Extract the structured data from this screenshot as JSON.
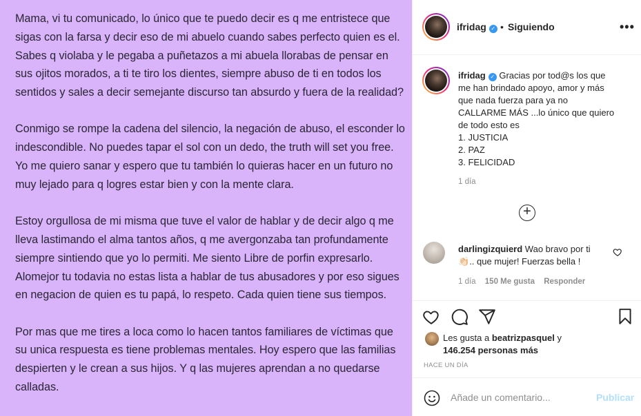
{
  "post_image": {
    "background_color": "#d9b4fb",
    "paragraphs": [
      "Mama, vi tu comunicado, lo único que te puedo decir es q me entristece que sigas con la farsa y decir eso de mi abuelo cuando sabes perfecto quien es el. Sabes q violaba y le pegaba a puñetazos a mi abuela llorabas de pensar en sus ojitos morados, a ti te tiro los dientes, siempre abuso de ti en todos los sentidos y sales a decir semejante discurso tan absurdo y fuera de la realidad?",
      "Conmigo se rompe la cadena del silencio, la negación de abuso, el esconder lo indescondible. No puedes tapar el sol con un dedo, the truth will set you free. Yo me quiero sanar y espero que tu también lo quieras hacer en un futuro no muy lejado para q logres estar bien y con la mente clara.",
      "Estoy orgullosa de mi misma que tuve el valor de hablar y de decir algo q me lleva lastimando el alma tantos años, q me avergonzaba tan profundamente siempre sintiendo que yo lo permiti. Me siento Libre de porfin expresarlo. Alomejor tu todavia no estas lista a hablar de tus abusadores y por eso sigues en negacion de quien es tu papá, lo respeto. Cada quien tiene sus tiempos.",
      "Por mas que me tires a loca como lo hacen tantos familiares de víctimas que su unica respuesta es tiene problemas mentales. Hoy espero que las familias despierten y le crean a sus hijos. Y q las mujeres aprendan a no quedarse calladas."
    ]
  },
  "header": {
    "username": "ifridag",
    "separator": "•",
    "follow_status": "Siguiendo",
    "more_label": "•••"
  },
  "caption": {
    "username": "ifridag",
    "lines": [
      "Gracias por tod@s los que",
      "me han brindado apoyo, amor y más",
      "que nada fuerza para ya no",
      "CALLARME MÁS ...lo único que quiero",
      "de todo esto es",
      "1. JUSTICIA",
      "2. PAZ",
      "3. FELICIDAD"
    ],
    "time": "1 día"
  },
  "load_more_label": "+",
  "comment": {
    "username": "darlingizquierd",
    "text_part1": "Wao bravo por ti",
    "text_part2": ".. que mujer! Fuerzas bella !",
    "time": "1 día",
    "likes": "150 Me gusta",
    "reply": "Responder"
  },
  "likes": {
    "prefix": "Les gusta a",
    "user": "beatrizpasquel",
    "conjunction": "y",
    "others": "146.254 personas más"
  },
  "posted_time": "HACE UN DÍA",
  "add_comment": {
    "placeholder": "Añade un comentario...",
    "publish_label": "Publicar"
  },
  "colors": {
    "verified": "#3897f0",
    "publish_disabled": "#b2dffc",
    "muted": "#8e8e8e"
  }
}
